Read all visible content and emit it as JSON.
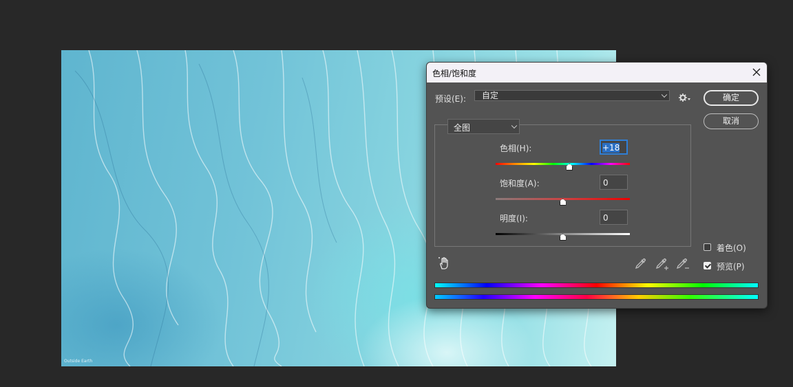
{
  "dialog": {
    "title": "色相/饱和度",
    "preset_label": "预设(E):",
    "preset_value": "自定",
    "ok_label": "确定",
    "cancel_label": "取消",
    "channel_value": "全图",
    "hue_label": "色相(H):",
    "hue_value": "+18",
    "saturation_label": "饱和度(A):",
    "saturation_value": "0",
    "lightness_label": "明度(I):",
    "lightness_value": "0",
    "colorize_label": "着色(O)",
    "colorize_checked": false,
    "preview_label": "预览(P)",
    "preview_checked": true
  },
  "sliders": {
    "hue": 18,
    "saturation": 0,
    "lightness": 0
  },
  "icons": {
    "close": "close-icon",
    "gear": "gear-icon",
    "targeted_adjust": "targeted-adjustment-hand-icon",
    "eyedropper": "eyedropper-icon",
    "eyedropper_add": "eyedropper-plus-icon",
    "eyedropper_subtract": "eyedropper-minus-icon"
  }
}
